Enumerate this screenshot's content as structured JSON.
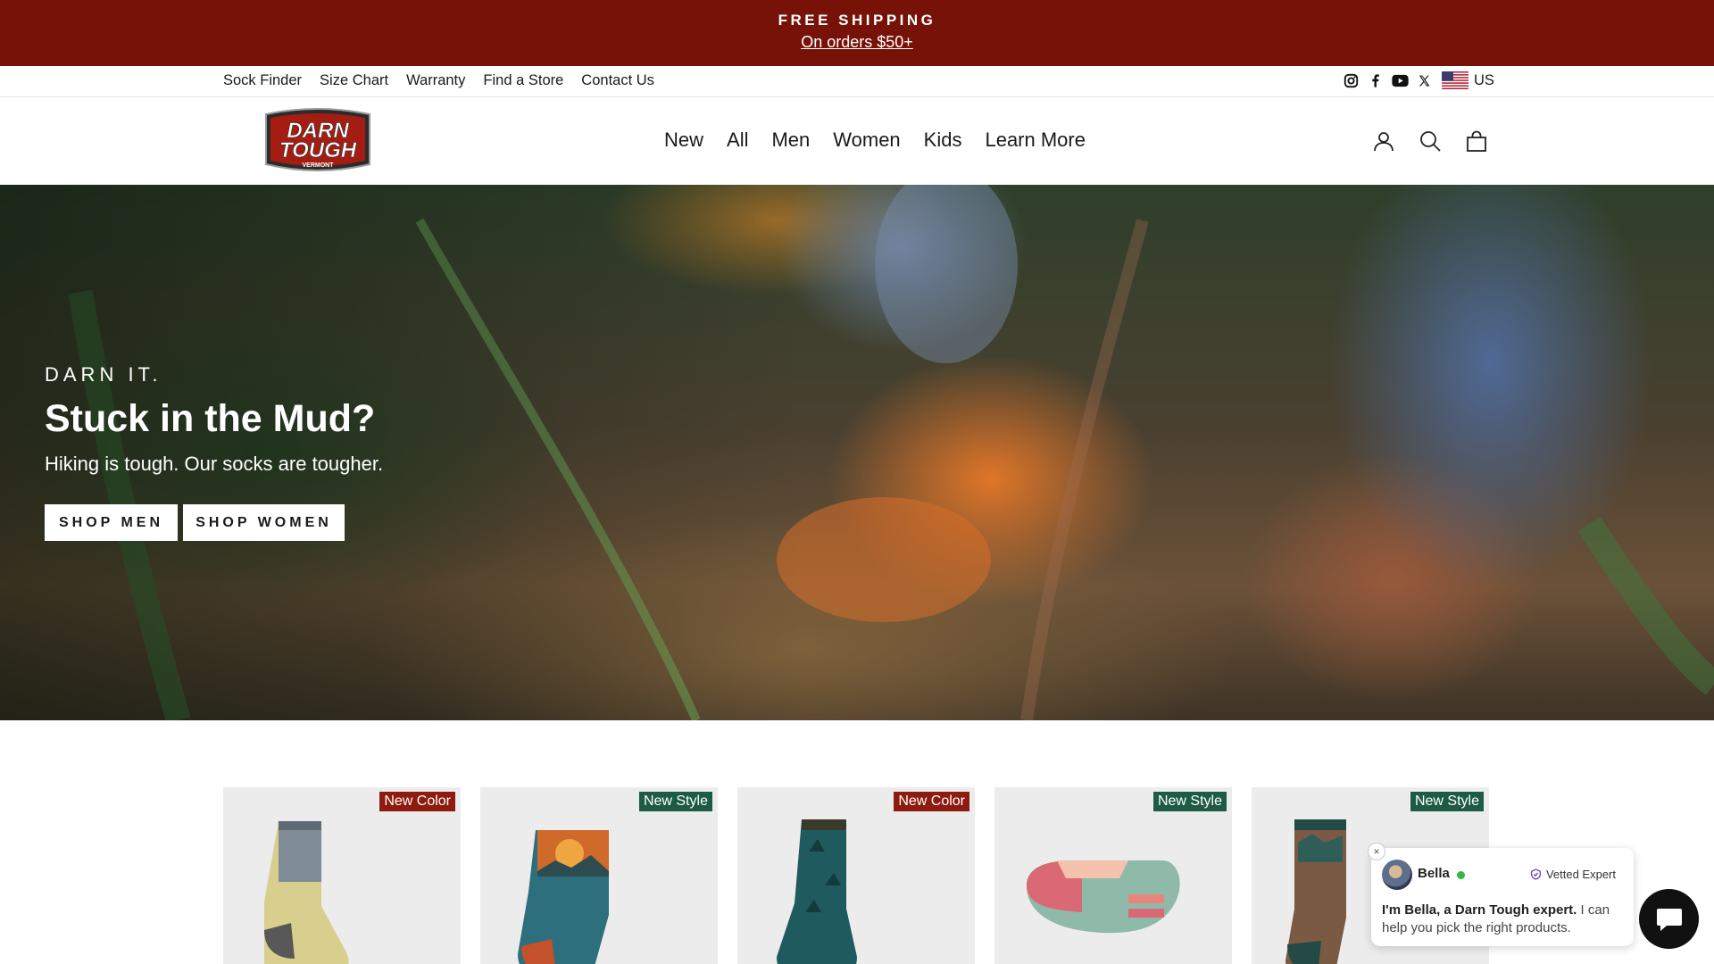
{
  "announcement": {
    "title": "FREE SHIPPING",
    "subtitle": "On orders $50+"
  },
  "utility_nav": {
    "links": [
      "Sock Finder",
      "Size Chart",
      "Warranty",
      "Find a Store",
      "Contact Us"
    ],
    "social_icons": [
      "instagram-icon",
      "facebook-icon",
      "youtube-icon",
      "x-icon"
    ],
    "country": "US"
  },
  "header": {
    "logo_text": {
      "line1": "DARN",
      "line2": "TOUGH",
      "line3": "VERMONT"
    },
    "nav": [
      "New",
      "All",
      "Men",
      "Women",
      "Kids",
      "Learn More"
    ],
    "icons": [
      "account-icon",
      "search-icon",
      "cart-icon"
    ]
  },
  "hero": {
    "eyebrow": "DARN IT.",
    "title": "Stuck in the Mud?",
    "subtitle": "Hiking is tough. Our socks are tougher.",
    "buttons": [
      "SHOP MEN",
      "SHOP WOMEN"
    ]
  },
  "products": [
    {
      "badge": "New Color",
      "badge_color": "#8e1b10"
    },
    {
      "badge": "New Style",
      "badge_color": "#1e5b45"
    },
    {
      "badge": "New Color",
      "badge_color": "#8e1b10"
    },
    {
      "badge": "New Style",
      "badge_color": "#1e5b45"
    },
    {
      "badge": "New Style",
      "badge_color": "#1e5b45"
    }
  ],
  "chat": {
    "agent_name": "Bella",
    "vetted_label": "Vetted Expert",
    "message_bold": "I'm Bella, a Darn Tough expert.",
    "message_rest": " I can help you pick the right products.",
    "close_symbol": "×"
  },
  "colors": {
    "announcement_bg": "#761208",
    "badge_new_color": "#8e1b10",
    "badge_new_style": "#1e5b45",
    "online_dot": "#2fba45"
  }
}
